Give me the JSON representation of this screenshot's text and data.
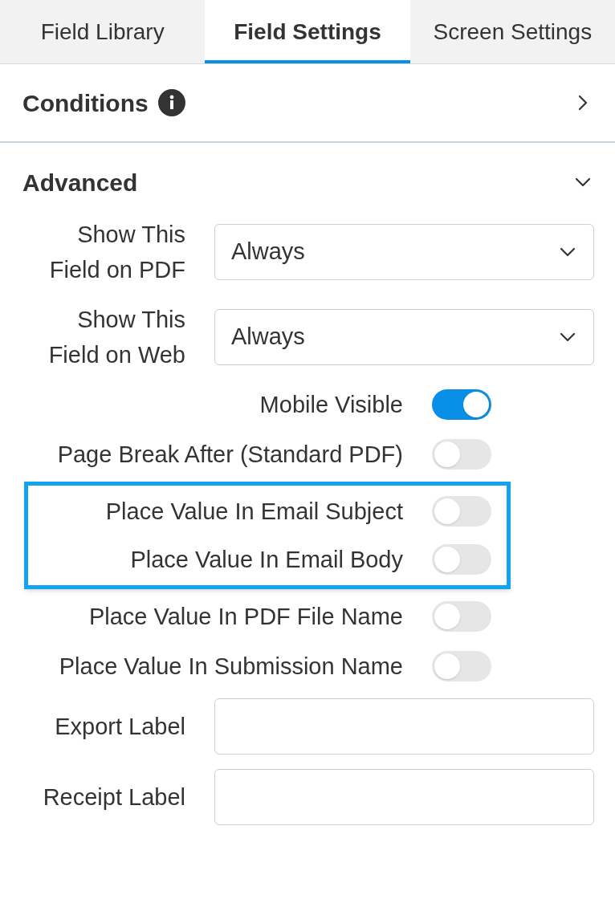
{
  "tabs": [
    {
      "label": "Field Library",
      "selected": false
    },
    {
      "label": "Field Settings",
      "selected": true
    },
    {
      "label": "Screen Settings",
      "selected": false
    }
  ],
  "conditions": {
    "title": "Conditions",
    "expanded": false
  },
  "advanced": {
    "title": "Advanced",
    "expanded": true,
    "fields": [
      {
        "kind": "select",
        "label": "Show This Field on PDF",
        "value": "Always"
      },
      {
        "kind": "select",
        "label": "Show This Field on Web",
        "value": "Always"
      },
      {
        "kind": "toggle",
        "label": "Mobile Visible",
        "on": true,
        "highlighted": false
      },
      {
        "kind": "toggle",
        "label": "Page Break After (Standard PDF)",
        "on": false,
        "highlighted": false
      },
      {
        "kind": "toggle",
        "label": "Place Value In Email Subject",
        "on": false,
        "highlighted": true
      },
      {
        "kind": "toggle",
        "label": "Place Value In Email Body",
        "on": false,
        "highlighted": true
      },
      {
        "kind": "toggle",
        "label": "Place Value In PDF File Name",
        "on": false,
        "highlighted": false
      },
      {
        "kind": "toggle",
        "label": "Place Value In Submission Name",
        "on": false,
        "highlighted": false
      },
      {
        "kind": "text",
        "label": "Export Label"
      },
      {
        "kind": "text",
        "label": "Receipt Label"
      }
    ]
  }
}
